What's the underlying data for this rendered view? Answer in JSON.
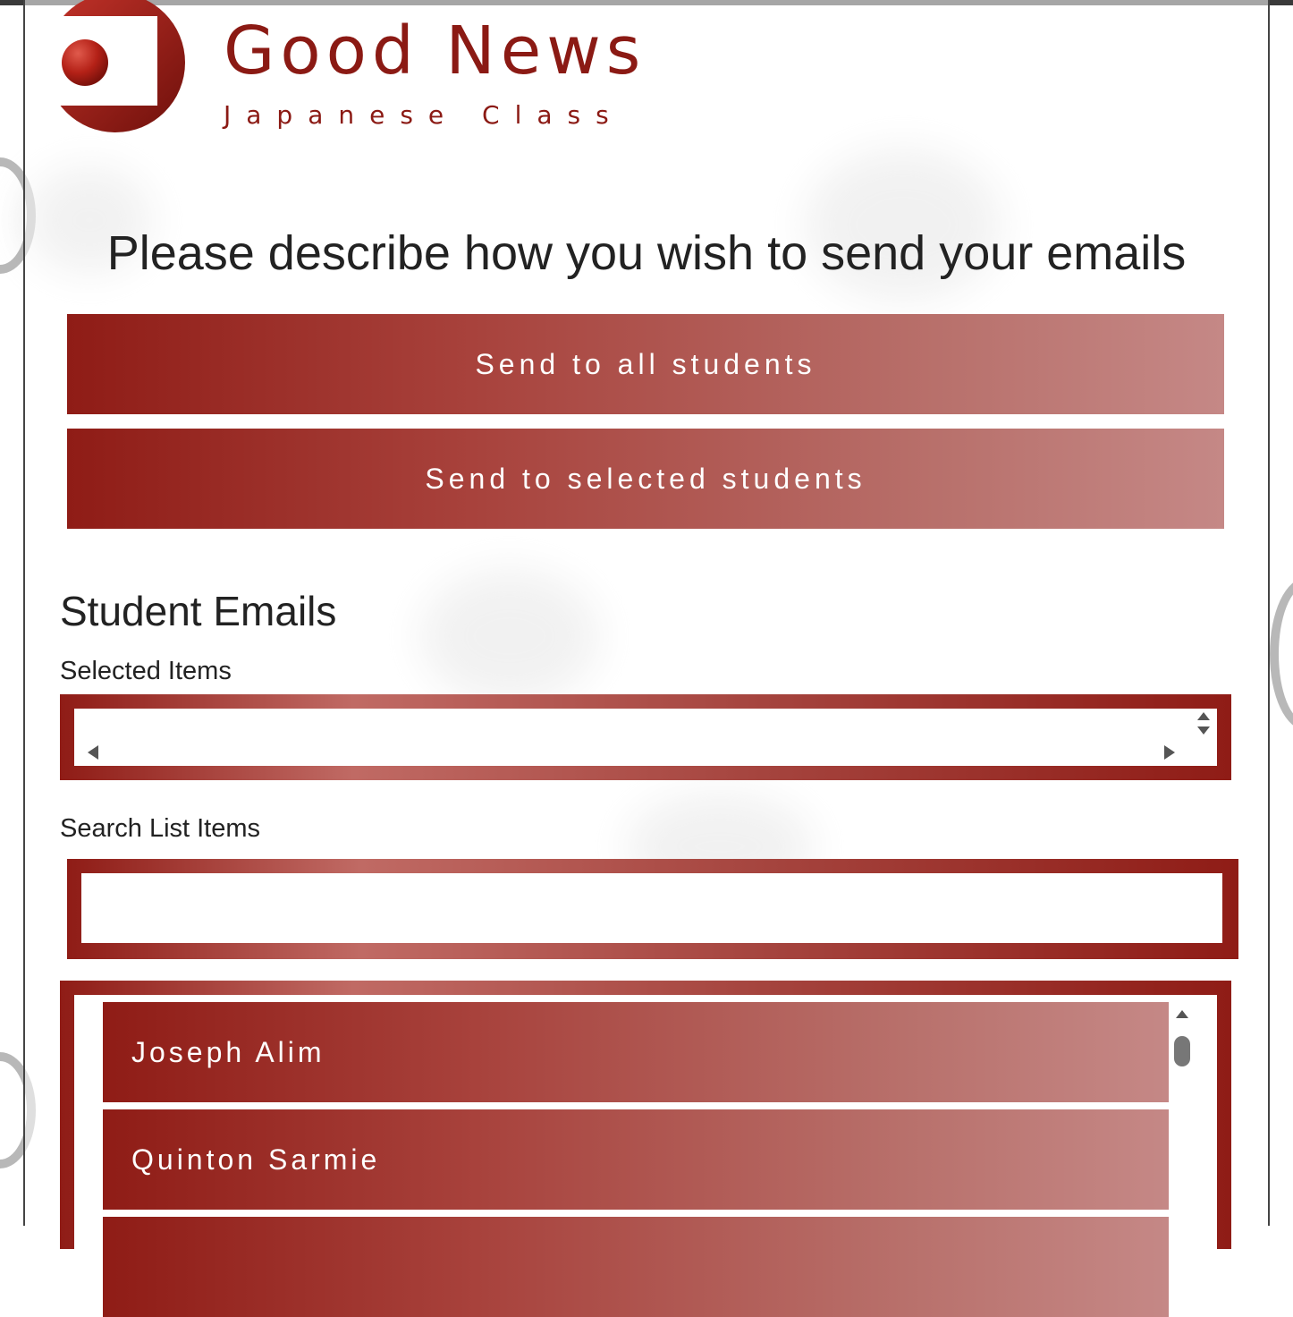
{
  "brand": {
    "title": "Good News",
    "subtitle": "Japanese Class",
    "color": "#8b1a14"
  },
  "heading": "Please describe how you wish to send your emails",
  "actions": {
    "send_all_label": "Send to all students",
    "send_selected_label": "Send to selected students"
  },
  "student_emails": {
    "section_title": "Student Emails",
    "selected_items_label": "Selected Items",
    "search_label": "Search List Items",
    "search_value": "",
    "items": [
      {
        "name": "Joseph Alim"
      },
      {
        "name": "Quinton Sarmie"
      },
      {
        "name": ""
      }
    ]
  },
  "colors": {
    "accent_dark": "#8f1c16",
    "accent_light": "#c58886",
    "text": "#222222"
  }
}
